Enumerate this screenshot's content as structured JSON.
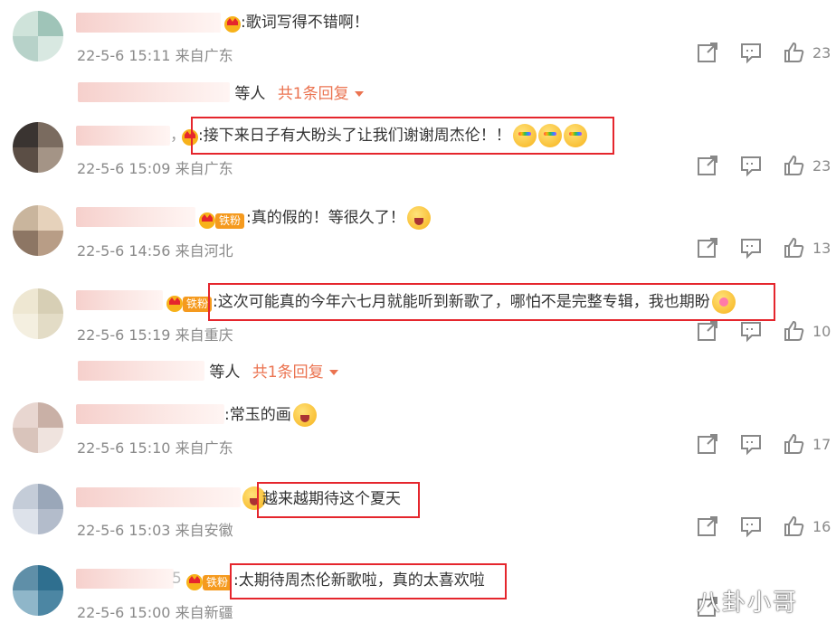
{
  "comments": [
    {
      "text": ":歌词写得不错啊！",
      "time": "22-5-6 15:11",
      "location": "来自广东",
      "likes": "23",
      "badge": "",
      "emojis": [],
      "highlighted": false
    },
    {
      "text": ":接下来日子有大盼头了让我们谢谢周杰伦！！",
      "time": "22-5-6 15:09",
      "location": "来自广东",
      "likes": "23",
      "badge": "",
      "emojis": [
        "rainbow-face-emoji",
        "rainbow-face-emoji",
        "rainbow-face-emoji"
      ],
      "highlighted": true
    },
    {
      "text": ":真的假的！等很久了！",
      "time": "22-5-6 14:56",
      "location": "来自河北",
      "likes": "13",
      "badge": "铁粉",
      "emojis": [
        "shocked-face-emoji"
      ],
      "highlighted": false
    },
    {
      "text": ":这次可能真的今年六七月就能听到新歌了，哪怕不是完整专辑，我也期盼",
      "time": "22-5-6 15:19",
      "location": "来自重庆",
      "likes": "10",
      "badge": "铁粉",
      "emojis": [
        "flower-face-emoji"
      ],
      "highlighted": true
    },
    {
      "text": ":常玉的画",
      "time": "22-5-6 15:10",
      "location": "来自广东",
      "likes": "17",
      "badge": "",
      "emojis": [
        "cheer-face-emoji"
      ],
      "highlighted": false
    },
    {
      "text": "越来越期待这个夏天",
      "time": "22-5-6 15:03",
      "location": "来自安徽",
      "likes": "16",
      "badge": "",
      "emojis": [],
      "highlighted": true
    },
    {
      "text": ":太期待周杰伦新歌啦，真的太喜欢啦",
      "time": "22-5-6 15:00",
      "location": "来自新疆",
      "likes": "",
      "badge": "铁粉",
      "emojis": [],
      "highlighted": true
    }
  ],
  "replies": [
    {
      "who": "等人",
      "count": "共1条回复"
    },
    {
      "who": "等人",
      "count": "共1条回复"
    }
  ],
  "username_fragments": {
    "c2_suffix": "，",
    "c7_suffix": "5"
  },
  "watermark": "八卦小哥",
  "colors": {
    "highlight": "#e5262d",
    "reply_link": "#eb7350",
    "meta": "#8a8a8a",
    "fan_badge": "#f59a1e"
  }
}
